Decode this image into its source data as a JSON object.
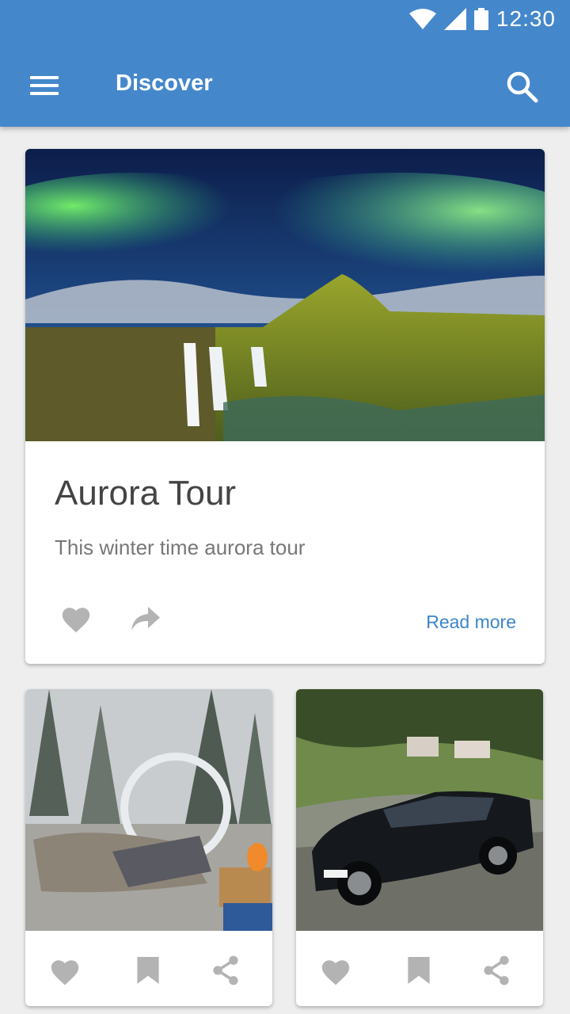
{
  "status_bar": {
    "time": "12:30"
  },
  "toolbar": {
    "title": "Discover"
  },
  "featured_card": {
    "title": "Aurora Tour",
    "subtitle": "This winter time aurora tour",
    "read_more_label": "Read more"
  },
  "colors": {
    "primary": "#4587cb",
    "accent": "#3d86c8",
    "icon_gray": "#b3b3b3"
  },
  "icons": [
    "menu-icon",
    "search-icon",
    "heart-icon",
    "share-arrow-icon",
    "bookmark-icon",
    "share-icon",
    "wifi-icon",
    "signal-icon",
    "battery-icon"
  ]
}
